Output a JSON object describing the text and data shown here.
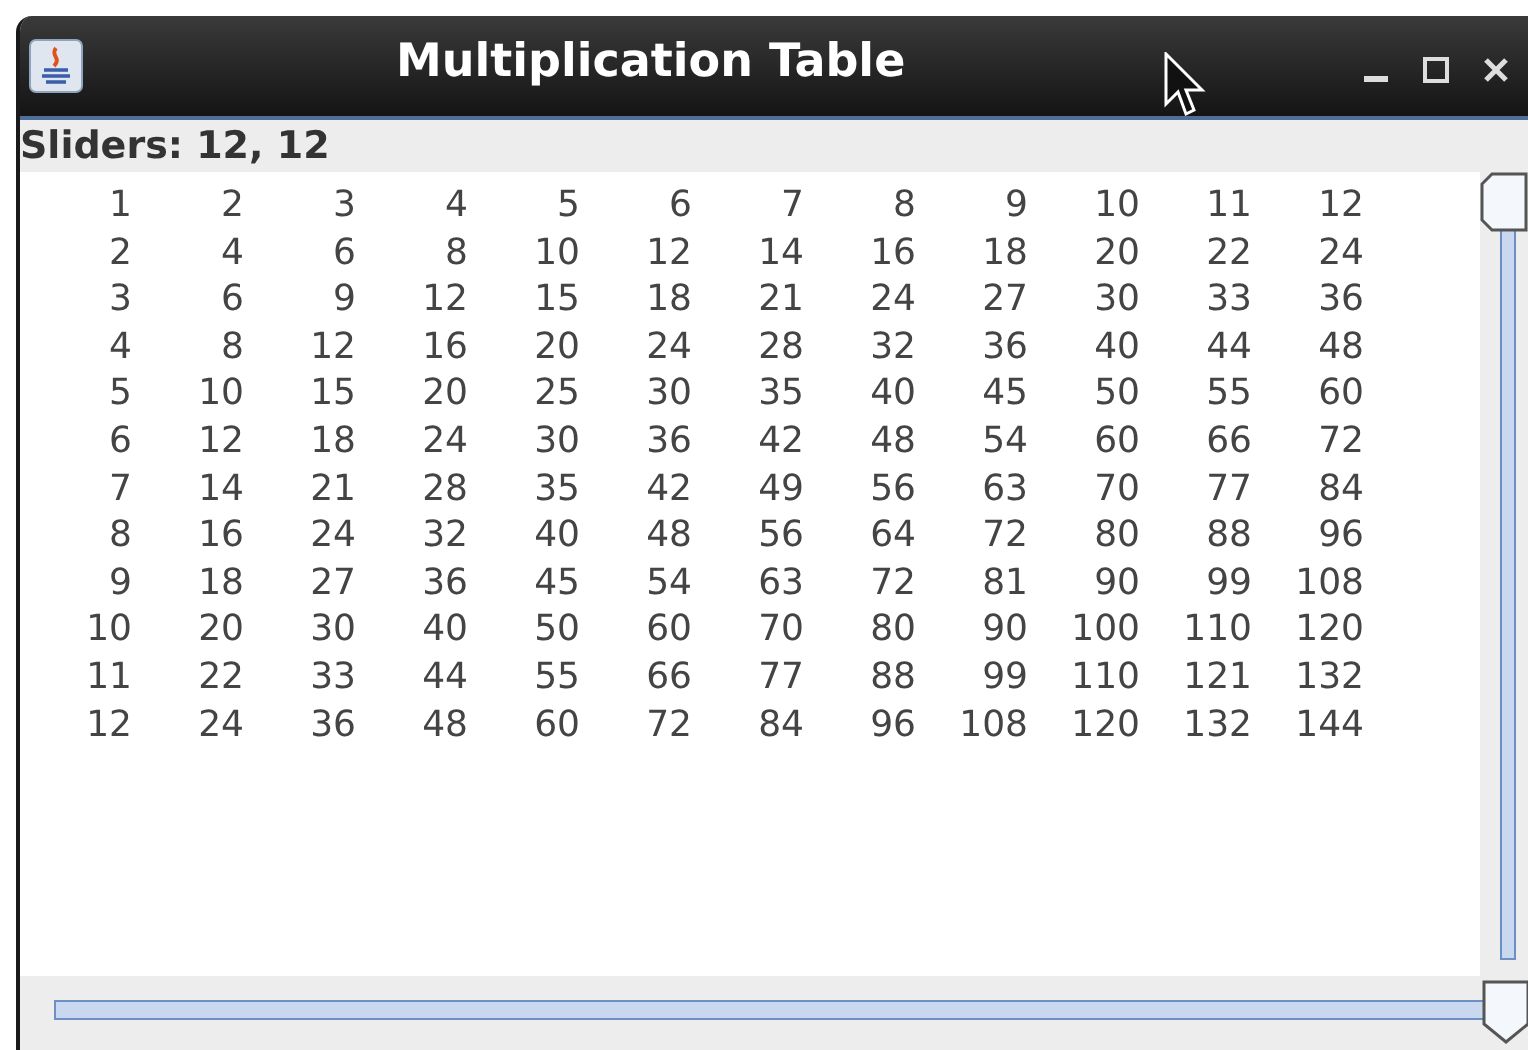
{
  "window": {
    "title": "Multiplication Table"
  },
  "label": "Sliders: 12, 12",
  "table": {
    "rows": [
      [
        "1",
        "2",
        "3",
        "4",
        "5",
        "6",
        "7",
        "8",
        "9",
        "10",
        "11",
        "12"
      ],
      [
        "2",
        "4",
        "6",
        "8",
        "10",
        "12",
        "14",
        "16",
        "18",
        "20",
        "22",
        "24"
      ],
      [
        "3",
        "6",
        "9",
        "12",
        "15",
        "18",
        "21",
        "24",
        "27",
        "30",
        "33",
        "36"
      ],
      [
        "4",
        "8",
        "12",
        "16",
        "20",
        "24",
        "28",
        "32",
        "36",
        "40",
        "44",
        "48"
      ],
      [
        "5",
        "10",
        "15",
        "20",
        "25",
        "30",
        "35",
        "40",
        "45",
        "50",
        "55",
        "60"
      ],
      [
        "6",
        "12",
        "18",
        "24",
        "30",
        "36",
        "42",
        "48",
        "54",
        "60",
        "66",
        "72"
      ],
      [
        "7",
        "14",
        "21",
        "28",
        "35",
        "42",
        "49",
        "56",
        "63",
        "70",
        "77",
        "84"
      ],
      [
        "8",
        "16",
        "24",
        "32",
        "40",
        "48",
        "56",
        "64",
        "72",
        "80",
        "88",
        "96"
      ],
      [
        "9",
        "18",
        "27",
        "36",
        "45",
        "54",
        "63",
        "72",
        "81",
        "90",
        "99",
        "108"
      ],
      [
        "10",
        "20",
        "30",
        "40",
        "50",
        "60",
        "70",
        "80",
        "90",
        "100",
        "110",
        "120"
      ],
      [
        "11",
        "22",
        "33",
        "44",
        "55",
        "66",
        "77",
        "88",
        "99",
        "110",
        "121",
        "132"
      ],
      [
        "12",
        "24",
        "36",
        "48",
        "60",
        "72",
        "84",
        "96",
        "108",
        "120",
        "132",
        "144"
      ]
    ]
  },
  "vertical_slider": {
    "level": 1
  },
  "horizontal_slider": {
    "level": 1
  }
}
